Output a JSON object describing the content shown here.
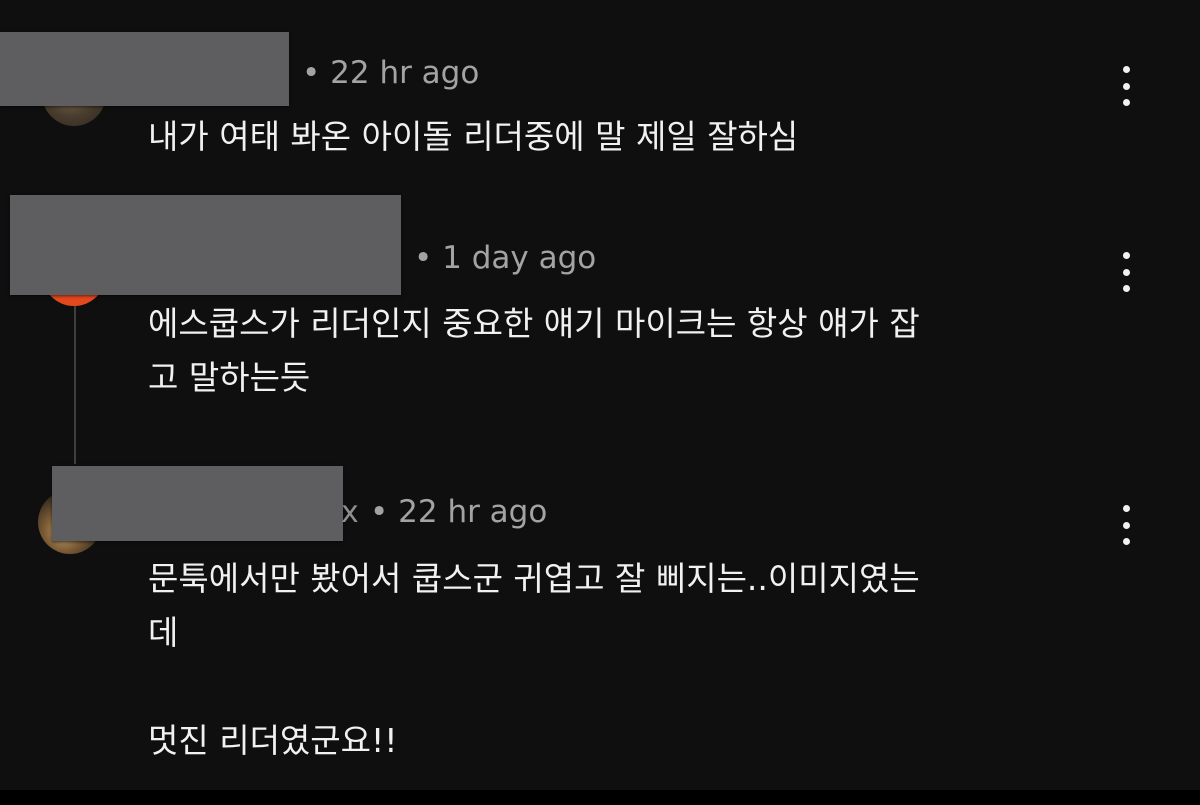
{
  "comments": [
    {
      "meta": "• 22 hr ago",
      "lines": [
        "내가 여태 봐온 아이돌 리더중에 말 제일 잘하심"
      ]
    },
    {
      "meta": "• 1 day ago",
      "lines": [
        "에스쿱스가 리더인지 중요한 얘기 마이크는 항상 얘가 잡",
        "고 말하는듯"
      ]
    },
    {
      "name_tail": "x",
      "meta": "• 22 hr ago",
      "lines": [
        "문툭에서만 봤어서 쿱스군 귀엽고 잘 삐지는..이미지였는",
        "데",
        "",
        "멋진 리더였군요!!"
      ]
    }
  ],
  "icons": {
    "menu": "more-vertical-icon"
  },
  "colors": {
    "background": "#0f0f0f",
    "text": "#f1f1f1",
    "meta": "#a3a3a3",
    "redaction": "#5e5e60",
    "avatar_2": "#e4491d"
  }
}
